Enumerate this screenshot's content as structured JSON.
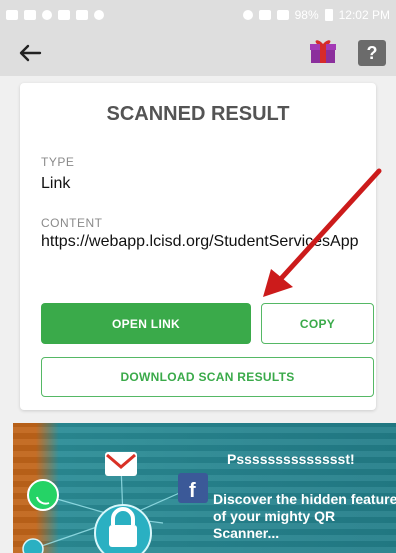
{
  "status_bar": {
    "battery": "98%",
    "time": "12:02 PM"
  },
  "toolbar": {
    "back_icon": "arrow-left-icon",
    "gift_icon": "gift-icon",
    "help_label": "?"
  },
  "card": {
    "title": "SCANNED RESULT",
    "type_label": "TYPE",
    "type_value": "Link",
    "content_label": "CONTENT",
    "content_value": "https://webapp.lcisd.org/StudentServicesApp",
    "open_link_label": "OPEN LINK",
    "copy_label": "COPY",
    "download_label": "DOWNLOAD SCAN RESULTS"
  },
  "promo": {
    "headline": "Psssssssssssssst!",
    "subtext": "Discover the hidden feature of your mighty QR Scanner..."
  },
  "colors": {
    "accent_green": "#3aaa4a",
    "arrow_red": "#cc1b1b",
    "promo_teal": "#1b8f9a"
  }
}
